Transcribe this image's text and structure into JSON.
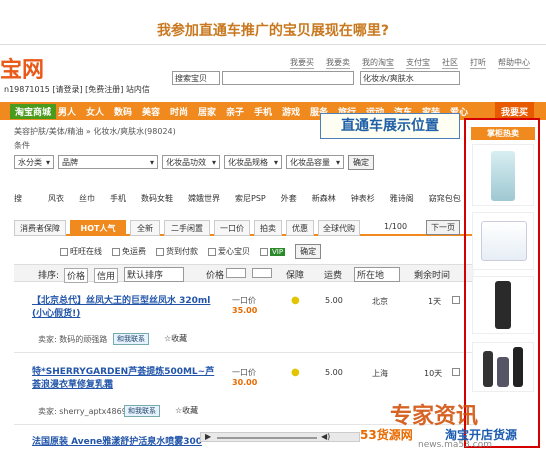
{
  "question": "我参加直通车推广的宝贝展现在哪里?",
  "logo": "宝网",
  "top_links": [
    "我要买",
    "我要卖",
    "我的淘宝",
    "支付宝",
    "社区",
    "打听",
    "帮助中心"
  ],
  "user_line": "n19871015 [请登录] [免费注册] 站内信",
  "search": {
    "scope": "搜索宝贝",
    "query": "",
    "category": "化妆水/爽肤水"
  },
  "nav": {
    "first": "淘宝商城",
    "items": [
      "男人",
      "女人",
      "数码",
      "美容",
      "时尚",
      "居家",
      "亲子",
      "手机",
      "游戏",
      "服务",
      "旅行",
      "运动",
      "汽车",
      "家装",
      "爱心"
    ],
    "last": "我要买"
  },
  "breadcrumb": "美容护肤/美体/精油 » 化妆水/爽肤水(98024)",
  "filter_label": "条件",
  "filters": [
    {
      "label": "水分类"
    },
    {
      "label": "品牌"
    },
    {
      "label": "化妆品功效"
    },
    {
      "label": "化妆品规格"
    },
    {
      "label": "化妆品容量"
    }
  ],
  "confirm_label": "确定",
  "brands_label": "搜",
  "brands": [
    "风衣",
    "丝巾",
    "手机",
    "数码女鞋",
    "嫦娥世界",
    "索尼PSP",
    "外套",
    "新森林",
    "钟表杉",
    "雅诗阁",
    "窈窕包包"
  ],
  "tabs": [
    "消费者保障",
    "HOT人气",
    "全新",
    "二手闲置",
    "一口价",
    "拍卖",
    "优惠",
    "全球代购"
  ],
  "pager": {
    "text": "1/100",
    "next": "下一页"
  },
  "checkboxes": [
    "旺旺在线",
    "免运费",
    "货到付款",
    "爱心宝贝",
    "VIP"
  ],
  "checkbox_confirm": "确定",
  "sortbar": {
    "sort": "排序:",
    "price_sort": "价格",
    "credit": "信用",
    "default": "默认排序",
    "price": "价格",
    "guarantee": "保障",
    "shipping": "运费",
    "location": "所在地",
    "remaining": "剩余时间"
  },
  "items": [
    {
      "title": "【北京总代】丝凤大王的巨型丝凤水 320ml (小心假货!)",
      "price_label": "一口价",
      "price": "35.00",
      "shipping": "5.00",
      "location": "北京",
      "remaining": "1天",
      "seller": "卖家: 数码的顽强路",
      "contact": "和我联系",
      "fav": "收藏"
    },
    {
      "title": "特*SHERRYGARDEN芦荟提炼500ML~芦荟浪漫衣草修复乳霜",
      "price_label": "一口价",
      "price": "30.00",
      "shipping": "5.00",
      "location": "上海",
      "remaining": "10天",
      "seller": "卖家: sherry_aptx4869",
      "contact": "和我联系",
      "fav": "收藏"
    },
    {
      "title": "法国原装 Avene雅漾舒护活泉水喷雾300ML",
      "price_label": "",
      "price": "",
      "shipping": "",
      "location": "",
      "remaining": "",
      "seller": "",
      "contact": "",
      "fav": ""
    }
  ],
  "callout": "直通车展示位置",
  "ad_header": "掌柜热卖",
  "watermark": {
    "main": "专家资讯",
    "sub1": "53货源网",
    "sub2": "淘宝开店货源",
    "url": "news.ma53.com"
  },
  "colors": {
    "accent": "#f08a1f",
    "callout_border": "#d40000",
    "title": "#c8781e"
  }
}
